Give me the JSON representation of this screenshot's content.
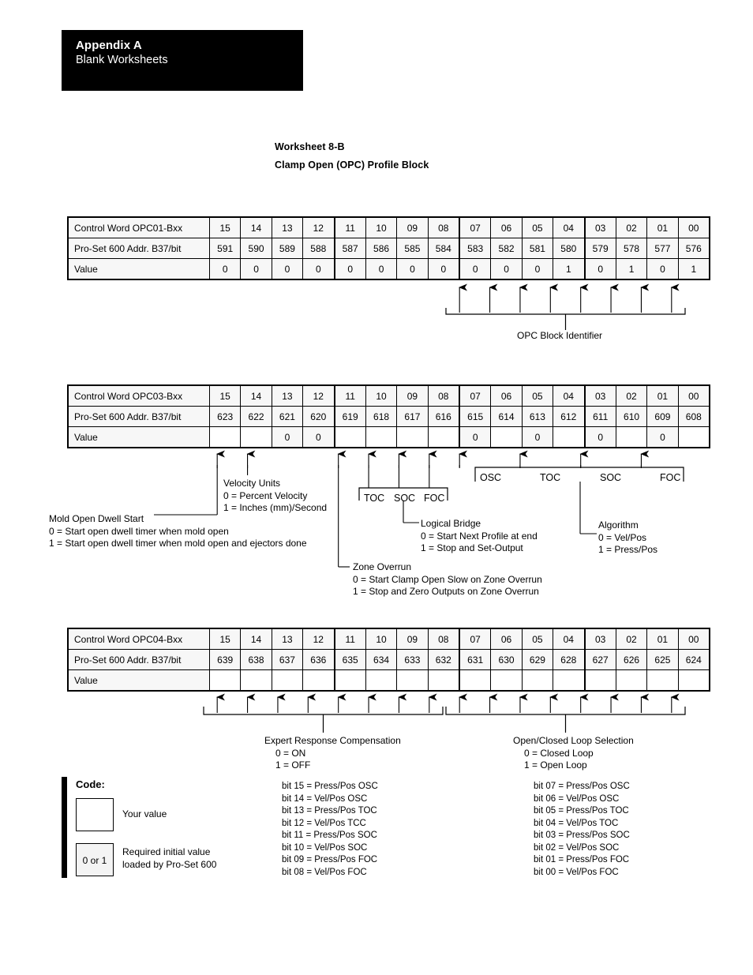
{
  "appendix": {
    "title": "Appendix A",
    "subtitle": "Blank Worksheets"
  },
  "worksheet": {
    "number": "Worksheet 8-B",
    "name": "Clamp Open (OPC) Profile Block"
  },
  "bit_columns": [
    "15",
    "14",
    "13",
    "12",
    "11",
    "10",
    "09",
    "08",
    "07",
    "06",
    "05",
    "04",
    "03",
    "02",
    "01",
    "00"
  ],
  "tables": [
    {
      "id": "opc01",
      "row_labels": {
        "control_word": "Control Word OPC01-Bxx",
        "address": "Pro-Set 600 Addr. B37/bit",
        "value": "Value"
      },
      "addresses": [
        "591",
        "590",
        "589",
        "588",
        "587",
        "586",
        "585",
        "584",
        "583",
        "582",
        "581",
        "580",
        "579",
        "578",
        "577",
        "576"
      ],
      "values": [
        "0",
        "0",
        "0",
        "0",
        "0",
        "0",
        "0",
        "0",
        "0",
        "0",
        "0",
        "1",
        "0",
        "1",
        "0",
        "1"
      ]
    },
    {
      "id": "opc03",
      "row_labels": {
        "control_word": "Control Word OPC03-Bxx",
        "address": "Pro-Set 600 Addr. B37/bit",
        "value": "Value"
      },
      "addresses": [
        "623",
        "622",
        "621",
        "620",
        "619",
        "618",
        "617",
        "616",
        "615",
        "614",
        "613",
        "612",
        "611",
        "610",
        "609",
        "608"
      ],
      "values": [
        "",
        "",
        "0",
        "0",
        "",
        "",
        "",
        "",
        "0",
        "",
        "0",
        "",
        "0",
        "",
        "0",
        ""
      ]
    },
    {
      "id": "opc04",
      "row_labels": {
        "control_word": "Control Word OPC04-Bxx",
        "address": "Pro-Set 600 Addr. B37/bit",
        "value": "Value"
      },
      "addresses": [
        "639",
        "638",
        "637",
        "636",
        "635",
        "634",
        "633",
        "632",
        "631",
        "630",
        "629",
        "628",
        "627",
        "626",
        "625",
        "624"
      ],
      "values": [
        "",
        "",
        "",
        "",
        "",
        "",
        "",
        "",
        "",
        "",
        "",
        "",
        "",
        "",
        "",
        ""
      ]
    }
  ],
  "annotations": {
    "opc_block_identifier": "OPC Block Identifier",
    "mold_open_dwell": {
      "heading": "Mold Open Dwell Start",
      "opt0": "0 = Start open dwell timer when mold open",
      "opt1": "1 = Start open dwell timer when mold open and ejectors done"
    },
    "velocity_units": {
      "heading": "Velocity Units",
      "opt0": "0 = Percent Velocity",
      "opt1": "1 = Inches (mm)/Second"
    },
    "zone_overrun": {
      "heading": "Zone Overrun",
      "opt0": "0 = Start Clamp Open Slow on Zone Overrun",
      "opt1": "1 = Stop and Zero Outputs on Zone Overrun"
    },
    "logical_bridge": {
      "heading": "Logical Bridge",
      "opt0": "0 = Start Next Profile at end",
      "opt1": "1 = Stop and Set-Output"
    },
    "algorithm": {
      "heading": "Algorithm",
      "opt0": "0 = Vel/Pos",
      "opt1": "1 = Press/Pos"
    },
    "expert_response": {
      "heading": "Expert Response Compensation",
      "opt0": "0 = ON",
      "opt1": "1 = OFF"
    },
    "open_closed_loop": {
      "heading": "Open/Closed Loop Selection",
      "opt0": "0 = Closed Loop",
      "opt1": "1 = Open Loop"
    },
    "bridge_tags": {
      "toc": "TOC",
      "soc": "SOC",
      "foc": "FOC"
    },
    "algorithm_tags": {
      "osc": "OSC",
      "toc": "TOC",
      "soc": "SOC",
      "foc": "FOC"
    }
  },
  "bit_lists": {
    "left": [
      "bit 15 = Press/Pos OSC",
      "bit 14 = Vel/Pos OSC",
      "bit 13 = Press/Pos TOC",
      "bit 12 = Vel/Pos TCC",
      "bit 11 = Press/Pos SOC",
      "bit 10 = Vel/Pos SOC",
      "bit 09 = Press/Pos FOC",
      "bit 08 = Vel/Pos FOC"
    ],
    "right": [
      "bit 07 = Press/Pos OSC",
      "bit 06 = Vel/Pos OSC",
      "bit 05 = Press/Pos TOC",
      "bit 04 = Vel/Pos TOC",
      "bit 03 = Press/Pos SOC",
      "bit 02 = Vel/Pos SOC",
      "bit 01 = Press/Pos FOC",
      "bit 00 = Vel/Pos FOC"
    ]
  },
  "code_legend": {
    "title": "Code:",
    "your_value_box": "",
    "your_value_label": "Your value",
    "initial_box": "0 or 1",
    "initial_label_line1": "Required initial value",
    "initial_label_line2": "loaded by Pro-Set 600"
  }
}
